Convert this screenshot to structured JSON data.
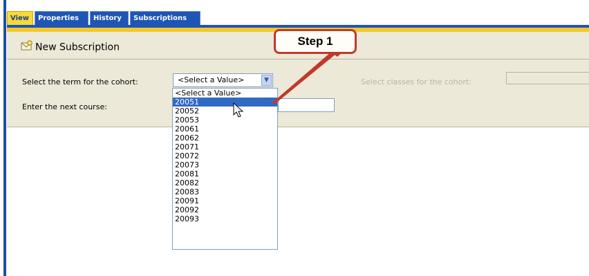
{
  "tabs": [
    {
      "label": "View",
      "active": true
    },
    {
      "label": "Properties",
      "active": false
    },
    {
      "label": "History",
      "active": false
    },
    {
      "label": "Subscriptions",
      "active": false
    }
  ],
  "toolbar": {
    "new_subscription": "New Subscription",
    "icon": "new-subscription-icon"
  },
  "form": {
    "term_label": "Select the term for the cohort:",
    "term_select_value": "<Select a Value>",
    "next_course_label": "Enter the next course:",
    "next_course_value": "",
    "classes_label": "Select classes for the cohort:"
  },
  "dropdown": {
    "options": [
      "<Select a Value>",
      "20051",
      "20052",
      "20053",
      "20061",
      "20062",
      "20071",
      "20072",
      "20073",
      "20081",
      "20082",
      "20083",
      "20091",
      "20092",
      "20093"
    ],
    "highlighted": "20051"
  },
  "callout": {
    "text": "Step 1"
  },
  "colors": {
    "tab_active": "#f7d93a",
    "tab_inactive": "#1f55b4",
    "panel": "#ece9d8",
    "highlight": "#316ac5",
    "callout_border": "#c0392b"
  }
}
